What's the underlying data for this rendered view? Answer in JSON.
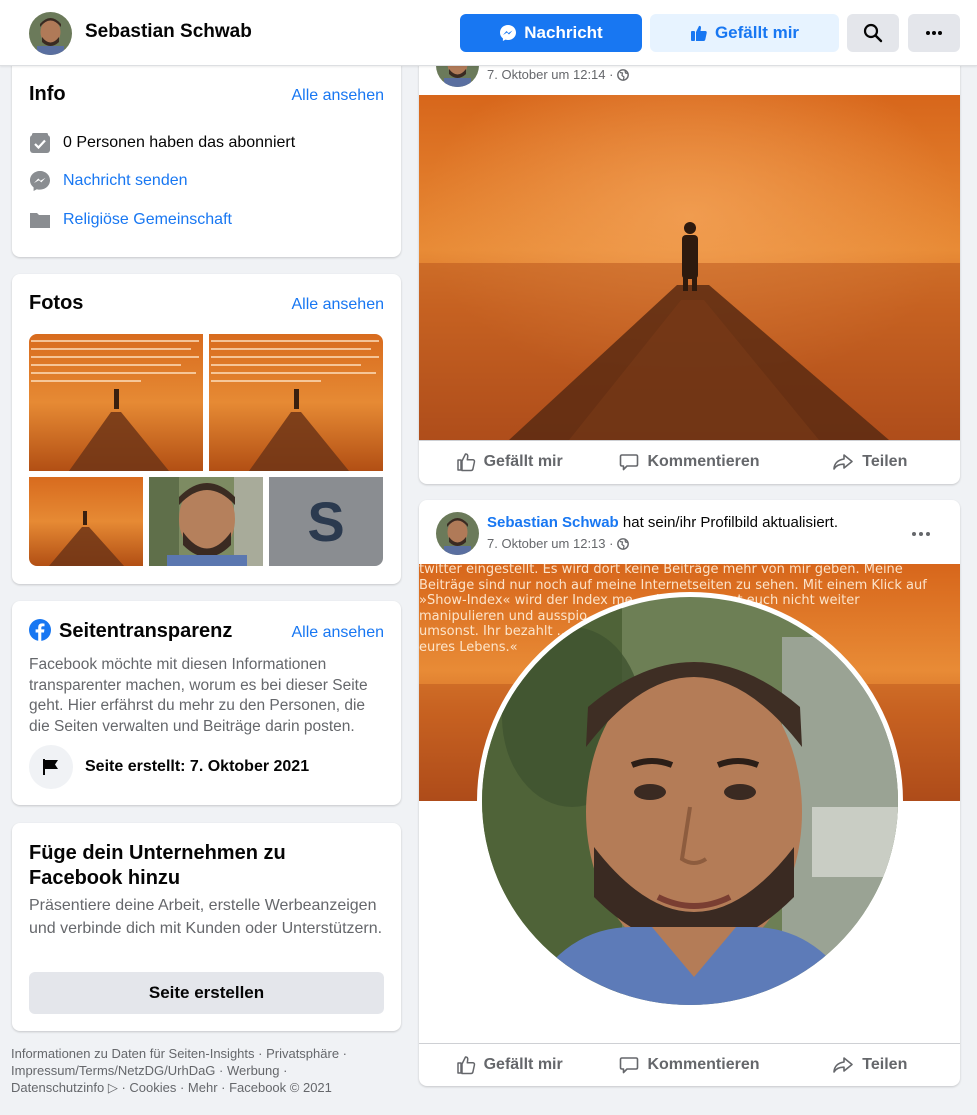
{
  "header": {
    "page_name": "Sebastian Schwab",
    "message_button": "Nachricht",
    "like_button": "Gefällt mir"
  },
  "info": {
    "title": "Info",
    "see_all": "Alle ansehen",
    "followers": "0 Personen haben das abonniert",
    "send_message": "Nachricht senden",
    "category": "Religiöse Gemeinschaft"
  },
  "photos": {
    "title": "Fotos",
    "see_all": "Alle ansehen",
    "letter_tile": "S"
  },
  "transparency": {
    "title": "Seitentransparenz",
    "see_all": "Alle ansehen",
    "text": "Facebook möchte mit diesen Informationen transparenter machen, worum es bei dieser Seite geht. Hier erfährst du mehr zu den Personen, die die Seiten verwalten und Beiträge darin posten.",
    "created": "Seite erstellt: 7. Oktober 2021"
  },
  "business": {
    "title": "Füge dein Unternehmen zu Facebook hinzu",
    "text": "Präsentiere deine Arbeit, erstelle Werbeanzeigen und verbinde dich mit Kunden oder Unterstützern.",
    "button": "Seite erstellen"
  },
  "footer": {
    "line1": "Informationen zu Daten für Seiten-Insights · Privatsphäre ·",
    "line2": "Impressum/Terms/NetzDG/UrhDaG · Werbung ·",
    "line3": "Datenschutzinfo ▷ · Cookies · Mehr · Facebook © 2021"
  },
  "post1": {
    "date": "7. Oktober um 12:14 ·"
  },
  "post2": {
    "author": "Sebastian Schwab",
    "action": "hat sein/ihr Profilbild aktualisiert.",
    "date": "7. Oktober um 12:13 ·",
    "overlay_line1": "twitter eingestellt. Es wird dort keine Beiträge mehr von mir geben. Meine",
    "overlay_line2": "Beiträge sind nur noch auf meine Internetseiten zu sehen. Mit einem Klick auf",
    "overlay_line3": "»Show-Index« wird der Index me... sichtbar. Lasst euch nicht weiter",
    "overlay_line4": "manipulieren und ausspio... ...d twitter sind nicht",
    "overlay_line5": "umsonst. Ihr bezahlt ... das für den Rest",
    "overlay_line6": "eures Lebens.«"
  },
  "actions": {
    "like": "Gefällt mir",
    "comment": "Kommentieren",
    "share": "Teilen"
  },
  "colors": {
    "facebook_blue": "#1877f2",
    "light_blue": "#e7f3ff",
    "background": "#f0f2f5"
  }
}
